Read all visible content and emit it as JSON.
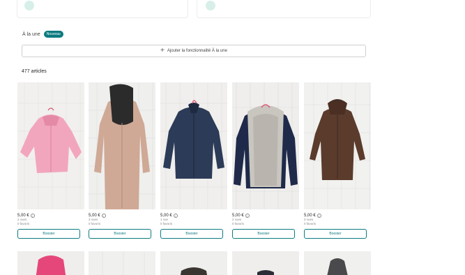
{
  "featured": {
    "label": "À la une",
    "badge": "Nouveau",
    "add_button": "Ajouter la fonctionnalité À la une",
    "add_icon": "plus-icon"
  },
  "wardrobe": {
    "article_count": "477 articles"
  },
  "items": [
    {
      "price": "5,00 €",
      "views": "2 vues",
      "favorites": "0 favoris",
      "boost": "Booster",
      "color": "#f2a6be"
    },
    {
      "price": "5,00 €",
      "views": "3 vues",
      "favorites": "0 favoris",
      "boost": "Booster",
      "color": "#c9a48a"
    },
    {
      "price": "5,00 €",
      "views": "1 vue",
      "favorites": "0 favoris",
      "boost": "Booster",
      "color": "#2c3b57"
    },
    {
      "price": "5,00 €",
      "views": "2 vues",
      "favorites": "0 favoris",
      "boost": "Booster",
      "color": "#1f2a4a"
    },
    {
      "price": "5,00 €",
      "views": "0 vues",
      "favorites": "0 favoris",
      "boost": "Booster",
      "color": "#5a3b2c"
    }
  ],
  "colors": {
    "accent": "#0b7a80"
  }
}
